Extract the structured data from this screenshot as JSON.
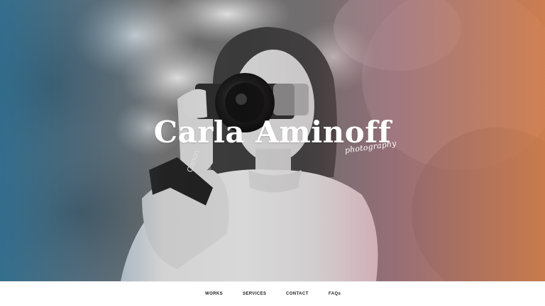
{
  "hero": {
    "image_icon": "photographer-holding-camera-image",
    "gradient_colors": [
      "#236e96",
      "#787878",
      "#c86e82",
      "#e68246"
    ]
  },
  "brand": {
    "name": "Carla Aminoff",
    "tagline": "photography"
  },
  "nav": {
    "items": [
      "WORKS",
      "SERVICES",
      "CONTACT",
      "FAQs"
    ]
  }
}
